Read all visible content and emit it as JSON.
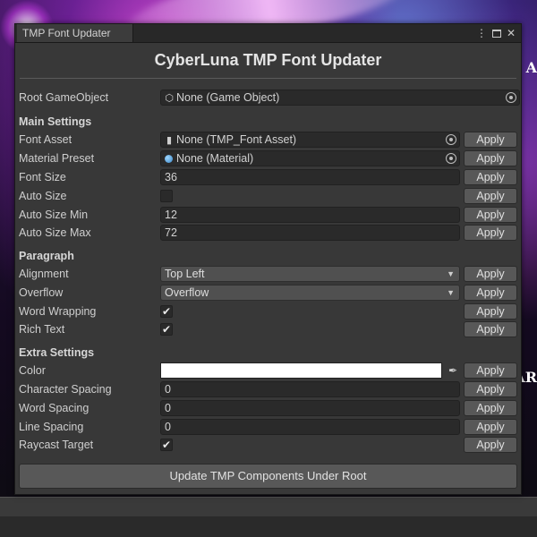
{
  "window": {
    "tab_title": "TMP Font Updater",
    "heading": "CyberLuna TMP Font Updater"
  },
  "root": {
    "label": "Root GameObject",
    "value": "None (Game Object)"
  },
  "main_settings": {
    "title": "Main Settings",
    "font_asset": {
      "label": "Font Asset",
      "value": "None (TMP_Font Asset)"
    },
    "material_preset": {
      "label": "Material Preset",
      "value": "None (Material)"
    },
    "font_size": {
      "label": "Font Size",
      "value": "36"
    },
    "auto_size": {
      "label": "Auto Size",
      "checked": false
    },
    "auto_size_min": {
      "label": "Auto Size Min",
      "value": "12"
    },
    "auto_size_max": {
      "label": "Auto Size Max",
      "value": "72"
    }
  },
  "paragraph": {
    "title": "Paragraph",
    "alignment": {
      "label": "Alignment",
      "value": "Top Left"
    },
    "overflow": {
      "label": "Overflow",
      "value": "Overflow"
    },
    "word_wrapping": {
      "label": "Word Wrapping",
      "checked": true
    },
    "rich_text": {
      "label": "Rich Text",
      "checked": true
    }
  },
  "extra_settings": {
    "title": "Extra Settings",
    "color": {
      "label": "Color",
      "value": "#ffffff"
    },
    "character_spacing": {
      "label": "Character Spacing",
      "value": "0"
    },
    "word_spacing": {
      "label": "Word Spacing",
      "value": "0"
    },
    "line_spacing": {
      "label": "Line Spacing",
      "value": "0"
    },
    "raycast_target": {
      "label": "Raycast Target",
      "checked": true
    }
  },
  "buttons": {
    "apply_label": "Apply",
    "update_label": "Update TMP Components Under Root"
  },
  "icons": {
    "kebab": "⋮",
    "close": "✕",
    "check": "✔",
    "dropdown_arrow": "▼",
    "game_object": "⬡",
    "font_asset": "▮",
    "eyedropper": "✒"
  },
  "background_text": {
    "right_top": "A",
    "right_bottom": "AR"
  }
}
